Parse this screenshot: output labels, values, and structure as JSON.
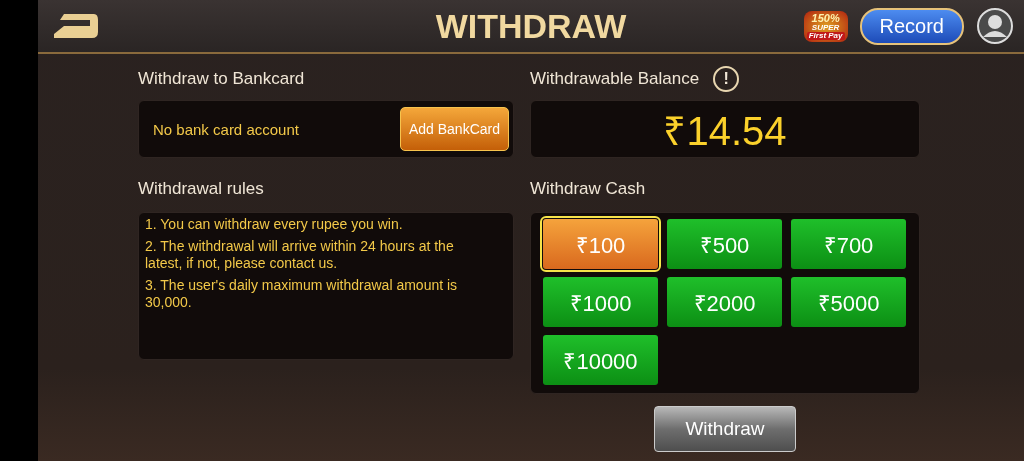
{
  "header": {
    "title": "WITHDRAW",
    "promo": {
      "percent": "150%",
      "line1": "SUPER",
      "line2": "First Pay"
    },
    "record_button": "Record"
  },
  "bankcard": {
    "title": "Withdraw to Bankcard",
    "message": "No bank card account",
    "add_button": "Add BankCard"
  },
  "rules": {
    "title": "Withdrawal rules",
    "items": [
      "1. You can withdraw every rupee you win.",
      "2. The withdrawal will arrive within 24 hours at the latest, if not, please contact us.",
      "3. The user's daily maximum withdrawal amount is 30,000."
    ]
  },
  "balance": {
    "title": "Withdrawable Balance",
    "info_icon": "!",
    "amount": "₹14.54"
  },
  "cash": {
    "title": "Withdraw Cash",
    "amounts": [
      {
        "label": "₹100",
        "selected": true
      },
      {
        "label": "₹500",
        "selected": false
      },
      {
        "label": "₹700",
        "selected": false
      },
      {
        "label": "₹1000",
        "selected": false
      },
      {
        "label": "₹2000",
        "selected": false
      },
      {
        "label": "₹5000",
        "selected": false
      },
      {
        "label": "₹10000",
        "selected": false
      }
    ]
  },
  "withdraw_button": "Withdraw"
}
